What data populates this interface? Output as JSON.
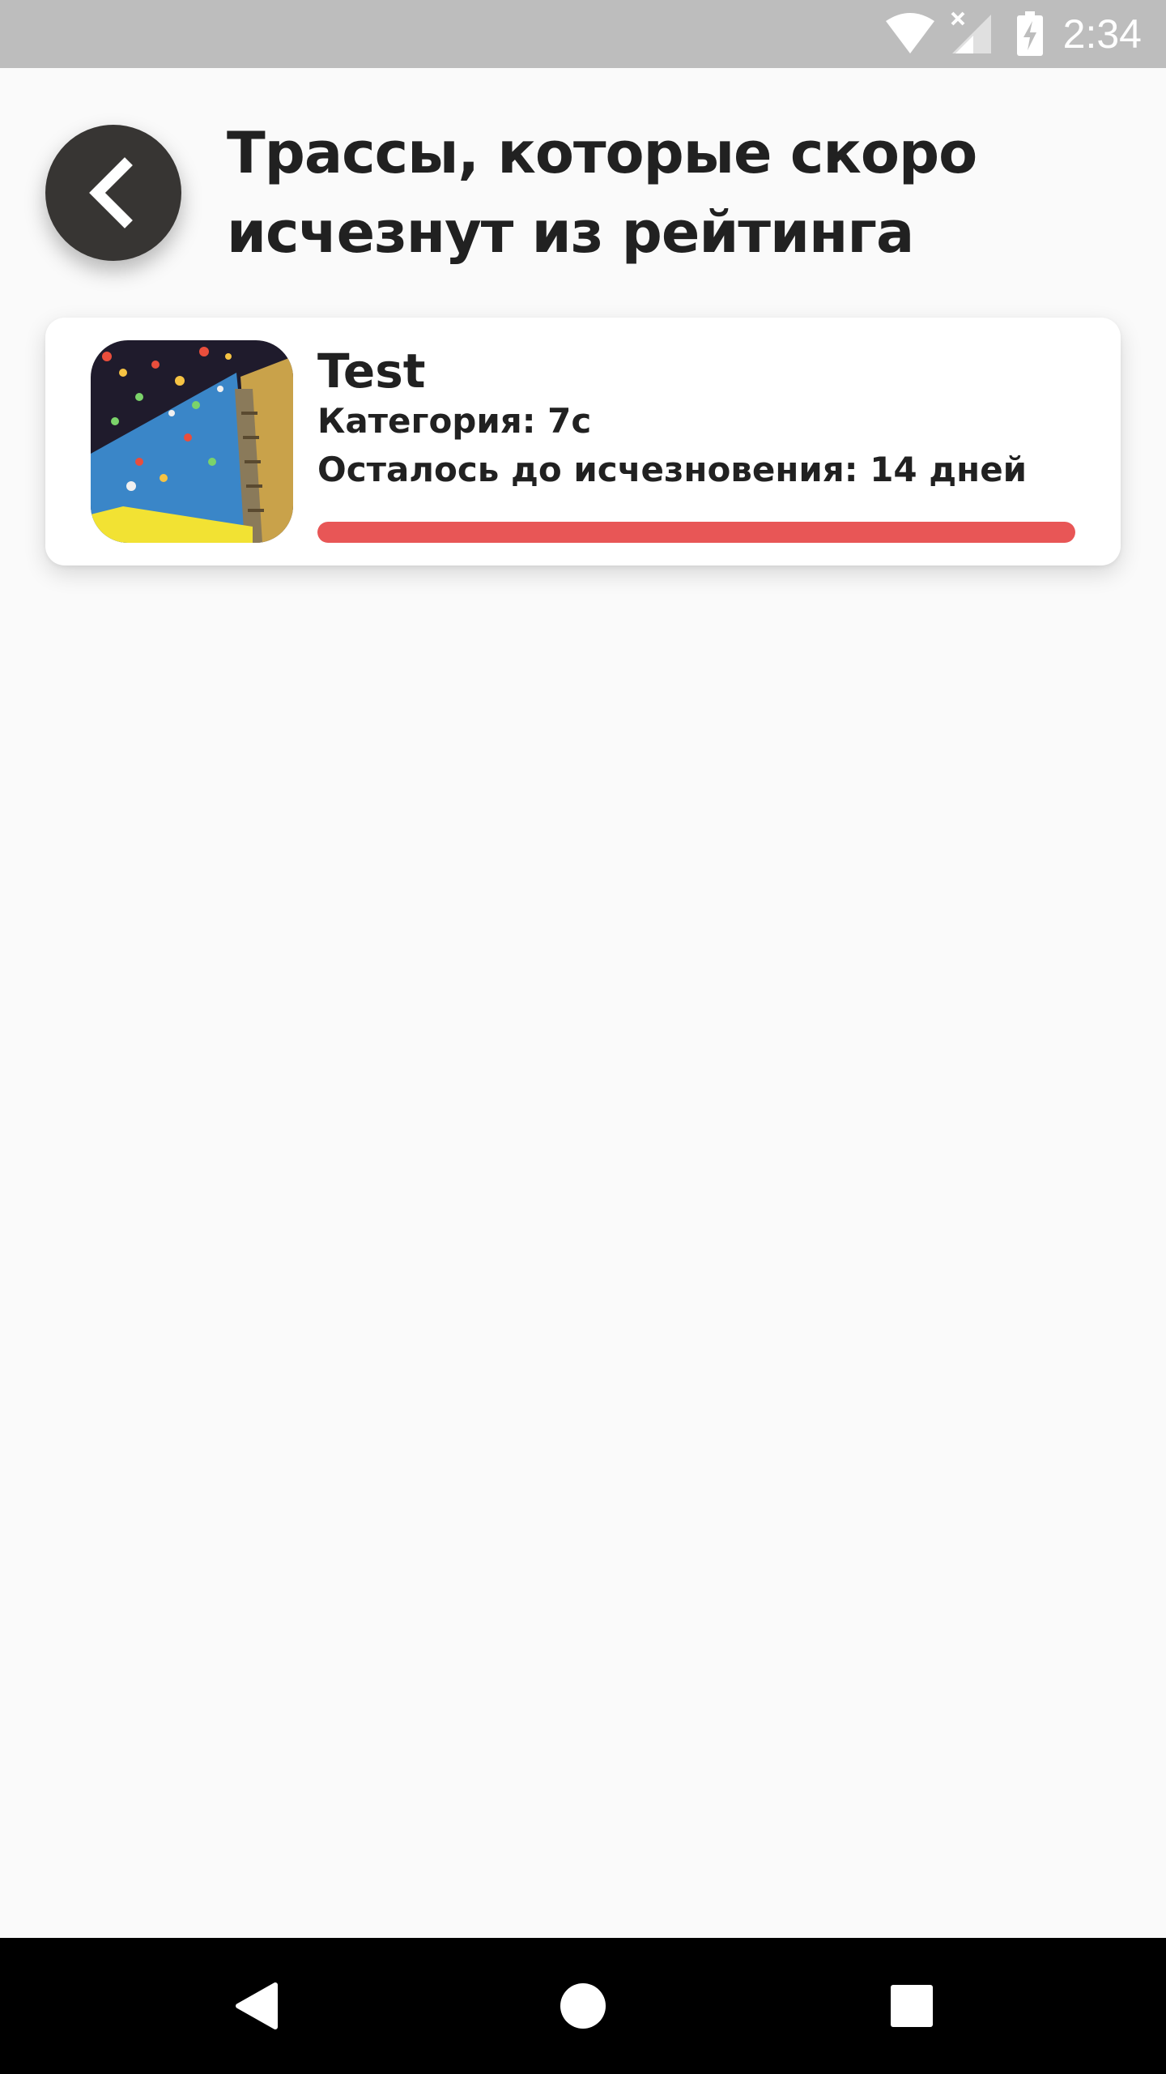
{
  "status_bar": {
    "time": "2:34",
    "icons": [
      "wifi-icon",
      "signal-no-sim-icon",
      "battery-charging-icon"
    ]
  },
  "header": {
    "back_icon": "chevron-left-icon",
    "title": "Трассы, которые скоро исчезнут из рейтинга"
  },
  "routes": [
    {
      "name": "Test",
      "category": "Категория: 7c",
      "remaining": "Осталось до исчезновения: 14 дней",
      "progress_fraction": 1.0,
      "progress_color": "#e85656"
    }
  ],
  "nav_bar": {
    "icons": [
      "back-triangle-icon",
      "home-circle-icon",
      "recents-square-icon"
    ]
  },
  "colors": {
    "status_bar_bg": "#bdbdbd",
    "background": "#fafafa",
    "back_button_bg": "#373533",
    "card_bg": "#ffffff",
    "nav_bar_bg": "#000000"
  }
}
